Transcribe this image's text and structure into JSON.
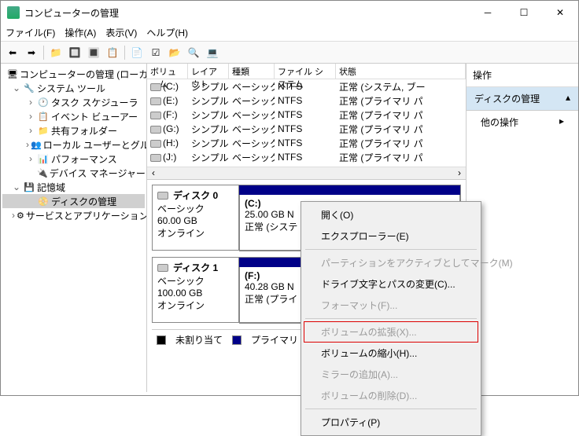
{
  "window": {
    "title": "コンピューターの管理"
  },
  "menu": {
    "file": "ファイル(F)",
    "action": "操作(A)",
    "view": "表示(V)",
    "help": "ヘルプ(H)"
  },
  "tree": {
    "root": "コンピューターの管理 (ローカル)",
    "systools": "システム ツール",
    "tasksched": "タスク スケジューラ",
    "eventvwr": "イベント ビューアー",
    "shared": "共有フォルダー",
    "users": "ローカル ユーザーとグループ",
    "perf": "パフォーマンス",
    "devmgr": "デバイス マネージャー",
    "storage": "記憶域",
    "diskmgmt": "ディスクの管理",
    "services": "サービスとアプリケーション"
  },
  "volcols": {
    "volume": "ボリューム",
    "layout": "レイアウト",
    "type": "種類",
    "fs": "ファイル システム",
    "status": "状態"
  },
  "vols": [
    {
      "v": "(C:)",
      "l": "シンプル",
      "t": "ベーシック",
      "f": "NTFS",
      "s": "正常 (システム, ブー"
    },
    {
      "v": "(E:)",
      "l": "シンプル",
      "t": "ベーシック",
      "f": "NTFS",
      "s": "正常 (プライマリ パ"
    },
    {
      "v": "(F:)",
      "l": "シンプル",
      "t": "ベーシック",
      "f": "NTFS",
      "s": "正常 (プライマリ パ"
    },
    {
      "v": "(G:)",
      "l": "シンプル",
      "t": "ベーシック",
      "f": "NTFS",
      "s": "正常 (プライマリ パ"
    },
    {
      "v": "(H:)",
      "l": "シンプル",
      "t": "ベーシック",
      "f": "NTFS",
      "s": "正常 (プライマリ パ"
    },
    {
      "v": "(J:)",
      "l": "シンプル",
      "t": "ベーシック",
      "f": "NTFS",
      "s": "正常 (プライマリ パ"
    }
  ],
  "disks": [
    {
      "name": "ディスク 0",
      "type": "ベーシック",
      "size": "60.00 GB",
      "status": "オンライン",
      "part": {
        "label": "(C:)",
        "size": "25.00 GB N",
        "status": "正常 (システ"
      }
    },
    {
      "name": "ディスク 1",
      "type": "ベーシック",
      "size": "100.00 GB",
      "status": "オンライン",
      "part": {
        "label": "(F:)",
        "size": "40.28 GB N",
        "status": "正常 (プライ"
      }
    }
  ],
  "legend": {
    "unalloc": "未割り当て",
    "primary": "プライマリ パーティ"
  },
  "actions": {
    "title": "操作",
    "section": "ディスクの管理",
    "item": "他の操作"
  },
  "ctx": {
    "open": "開く(O)",
    "explorer": "エクスプローラー(E)",
    "active": "パーティションをアクティブとしてマーク(M)",
    "chdrive": "ドライブ文字とパスの変更(C)...",
    "format": "フォーマット(F)...",
    "extend": "ボリュームの拡張(X)...",
    "shrink": "ボリュームの縮小(H)...",
    "mirror": "ミラーの追加(A)...",
    "delete": "ボリュームの削除(D)...",
    "prop": "プロパティ(P)"
  }
}
